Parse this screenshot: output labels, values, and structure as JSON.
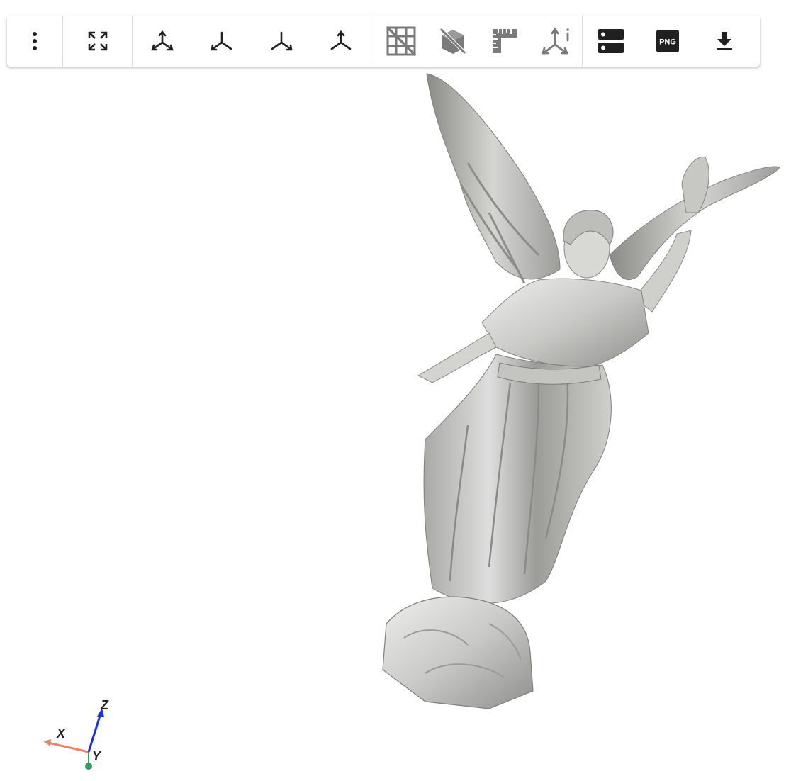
{
  "toolbar": {
    "buttons": [
      {
        "id": "menu",
        "icon": "more-vert-icon",
        "label": ""
      },
      {
        "id": "fullscreen",
        "icon": "fullscreen-icon",
        "label": ""
      },
      {
        "id": "view1",
        "icon": "axis-view-icon",
        "label": ""
      },
      {
        "id": "view2",
        "icon": "axis-view-icon",
        "label": ""
      },
      {
        "id": "view3",
        "icon": "axis-view-icon",
        "label": ""
      },
      {
        "id": "view4",
        "icon": "axis-view-icon",
        "label": ""
      },
      {
        "id": "grid",
        "icon": "grid-off-icon",
        "label": ""
      },
      {
        "id": "bounds",
        "icon": "bounds-off-icon",
        "label": ""
      },
      {
        "id": "ruler",
        "icon": "ruler-icon",
        "label": ""
      },
      {
        "id": "axes-info",
        "icon": "axes-info-icon",
        "label": ""
      },
      {
        "id": "server",
        "icon": "server-icon",
        "label": ""
      },
      {
        "id": "screenshot",
        "icon": "png-icon",
        "label": "PNG"
      },
      {
        "id": "download",
        "icon": "download-icon",
        "label": ""
      }
    ]
  },
  "orientation_widget": {
    "x_label": "X",
    "y_label": "Y",
    "z_label": "Z",
    "x_color": "#e8866a",
    "y_color": "#3a9b5c",
    "z_color": "#1f2fd6"
  },
  "scene": {
    "model_color": "#d9d9d6",
    "background": "#ffffff"
  }
}
